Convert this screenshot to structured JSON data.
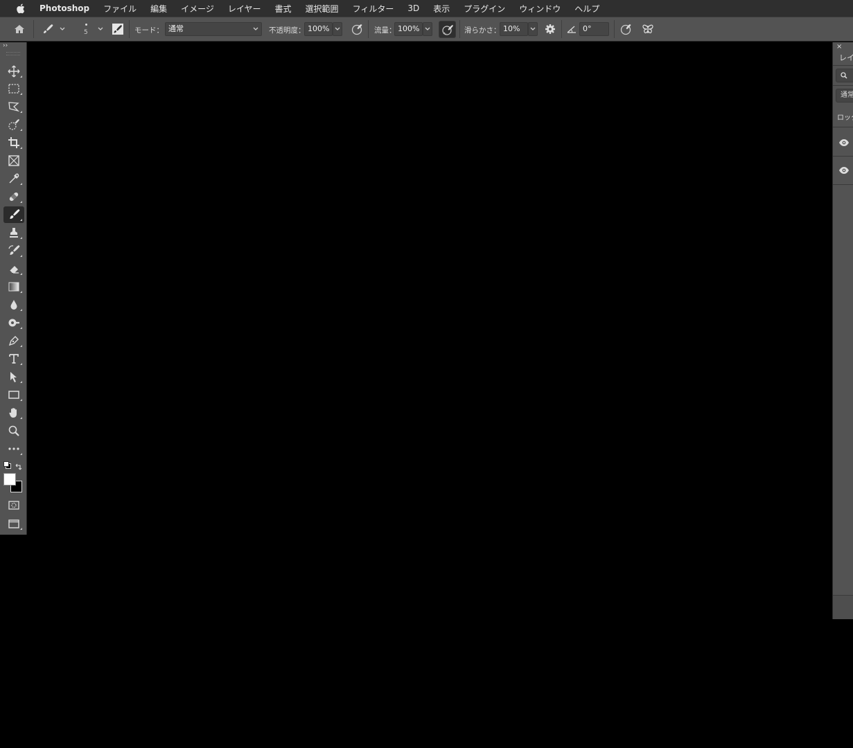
{
  "menubar": {
    "app_name": "Photoshop",
    "items": [
      "ファイル",
      "編集",
      "イメージ",
      "レイヤー",
      "書式",
      "選択範囲",
      "フィルター",
      "3D",
      "表示",
      "プラグイン",
      "ウィンドウ",
      "ヘルプ"
    ]
  },
  "options": {
    "brush_size": "5",
    "mode_label": "モード：",
    "mode_value": "通常",
    "opacity_label": "不透明度：",
    "opacity_value": "100%",
    "flow_label": "流量：",
    "flow_value": "100%",
    "smoothing_label": "滑らかさ：",
    "smoothing_value": "10%",
    "angle_value": "0°"
  },
  "toolbar": {
    "collapse_glyph": "››",
    "active_tool": "brush-tool"
  },
  "layers_panel": {
    "close_glyph": "×",
    "tab_label": "レイ",
    "blend_mode": "通常",
    "lock_label": "ロック"
  },
  "colors": {
    "menubar_bg": "#2f2f2f",
    "panel_bg": "#535353",
    "canvas_bg": "#000000",
    "foreground": "#ffffff",
    "background": "#000000"
  }
}
